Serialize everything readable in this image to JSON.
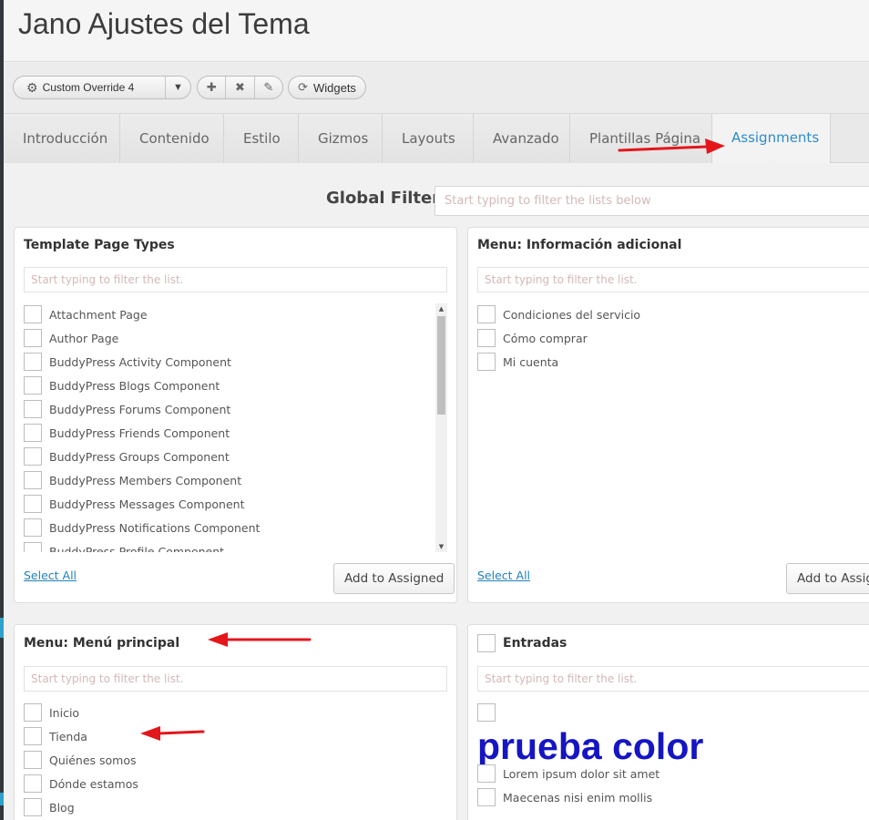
{
  "title": "Jano Ajustes del Tema",
  "toolbar": {
    "override_label": "Custom Override 4",
    "widgets_label": "Widgets"
  },
  "tabs": [
    {
      "label": "Introducción"
    },
    {
      "label": "Contenido"
    },
    {
      "label": "Estilo"
    },
    {
      "label": "Gizmos"
    },
    {
      "label": "Layouts"
    },
    {
      "label": "Avanzado"
    },
    {
      "label": "Plantillas Página"
    },
    {
      "label": "Assignments",
      "active": true
    }
  ],
  "global_filter": {
    "label": "Global Filter",
    "placeholder": "Start typing to filter the lists below"
  },
  "panels": {
    "template_page_types": {
      "title": "Template Page Types",
      "filter_placeholder": "Start typing to filter the list.",
      "items": [
        "Attachment Page",
        "Author Page",
        "BuddyPress Activity Component",
        "BuddyPress Blogs Component",
        "BuddyPress Forums Component",
        "BuddyPress Friends Component",
        "BuddyPress Groups Component",
        "BuddyPress Members Component",
        "BuddyPress Messages Component",
        "BuddyPress Notifications Component",
        "BuddyPress Profile Component"
      ],
      "select_all": "Select All",
      "add_button": "Add to Assigned"
    },
    "menu_info": {
      "title": "Menu: Información adicional",
      "filter_placeholder": "Start typing to filter the list.",
      "items": [
        "Condiciones del servicio",
        "Cómo comprar",
        "Mi cuenta"
      ],
      "select_all": "Select All",
      "add_button": "Add to Assigned"
    },
    "menu_principal": {
      "title": "Menu: Menú principal",
      "filter_placeholder": "Start typing to filter the list.",
      "items": [
        "Inicio",
        "Tienda",
        "Quiénes somos",
        "Dónde estamos",
        "Blog"
      ]
    },
    "entradas": {
      "title": "Entradas",
      "filter_placeholder": "Start typing to filter the list.",
      "highlight": "prueba color",
      "items": [
        "Lorem ipsum dolor sit amet",
        "Maecenas nisi enim mollis"
      ]
    }
  },
  "colors": {
    "accent": "#2d8dc7",
    "annotation_arrow": "#e3161c",
    "highlight_text": "#1515c4"
  }
}
